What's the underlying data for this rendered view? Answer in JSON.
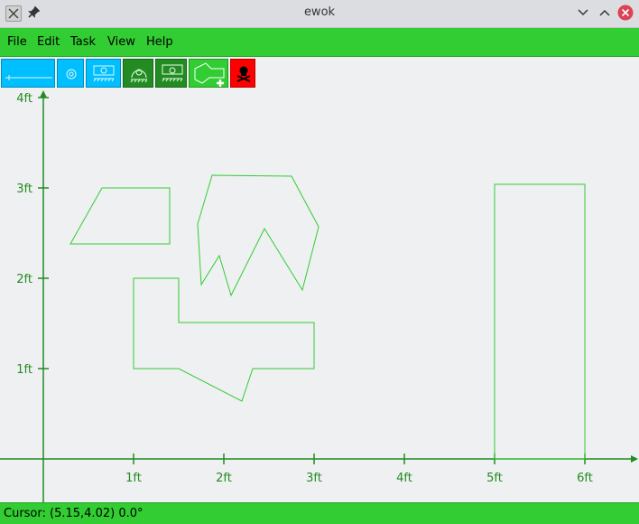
{
  "window": {
    "title": "ewok"
  },
  "menu": [
    "File",
    "Edit",
    "Task",
    "View",
    "Help"
  ],
  "toolbar": {
    "buttons": [
      {
        "icon": "ruler-icon",
        "color": "#00bfff"
      },
      {
        "icon": "sensor-icon",
        "color": "#00bfff"
      },
      {
        "icon": "robot-icon",
        "color": "#00bfff"
      },
      {
        "icon": "circle-robot-icon",
        "color": "#228b22"
      },
      {
        "icon": "robot-box-icon",
        "color": "#228b22"
      },
      {
        "icon": "add-path-icon",
        "color": "#32cd32"
      },
      {
        "icon": "skull-icon",
        "color": "#ff0000"
      }
    ]
  },
  "axes": {
    "x_ticks": [
      "1ft",
      "2ft",
      "3ft",
      "4ft",
      "5ft",
      "6ft"
    ],
    "y_ticks": [
      "1ft",
      "2ft",
      "3ft",
      "4ft"
    ],
    "color": "#228b22"
  },
  "shapes": [
    {
      "name": "trapezoid",
      "points": [
        [
          0.3,
          2.38
        ],
        [
          0.65,
          3.0
        ],
        [
          1.4,
          3.0
        ],
        [
          1.4,
          2.38
        ]
      ]
    },
    {
      "name": "jagged-polygon",
      "points": [
        [
          1.87,
          3.14
        ],
        [
          2.75,
          3.13
        ],
        [
          3.05,
          2.57
        ],
        [
          2.87,
          1.87
        ],
        [
          2.45,
          2.55
        ],
        [
          2.08,
          1.81
        ],
        [
          1.95,
          2.25
        ],
        [
          1.75,
          1.93
        ],
        [
          1.71,
          2.6
        ]
      ]
    },
    {
      "name": "l-shape",
      "points": [
        [
          1.0,
          2.0
        ],
        [
          1.5,
          2.0
        ],
        [
          1.5,
          1.51
        ],
        [
          3.0,
          1.51
        ],
        [
          3.0,
          1.0
        ],
        [
          2.32,
          1.0
        ],
        [
          2.2,
          0.64
        ],
        [
          1.5,
          1.0
        ],
        [
          1.0,
          1.0
        ]
      ]
    },
    {
      "name": "rectangle",
      "points": [
        [
          5.0,
          0.0
        ],
        [
          5.0,
          3.04
        ],
        [
          6.0,
          3.04
        ],
        [
          6.0,
          0.0
        ]
      ]
    }
  ],
  "status": {
    "text": "Cursor: (5.15,4.02)  0.0°"
  }
}
